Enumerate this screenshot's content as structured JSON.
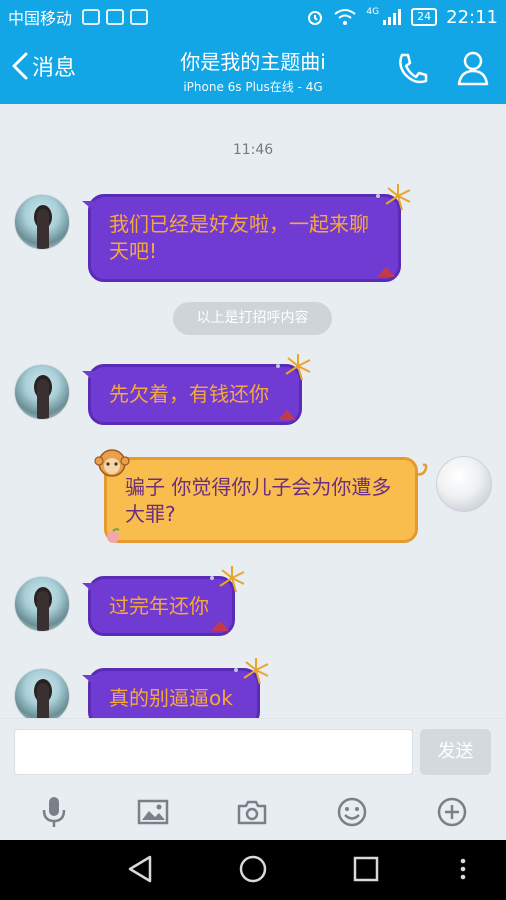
{
  "status_bar": {
    "carrier": "中国移动",
    "network": "4G",
    "battery": "24",
    "time": "22:11"
  },
  "header": {
    "back_label": "消息",
    "title": "你是我的主题曲i",
    "subtitle": "iPhone 6s Plus在线 - 4G",
    "icons": [
      "phone-icon",
      "profile-icon"
    ]
  },
  "messages": {
    "timestamp": "11:46",
    "notice": "以上是打招呼内容",
    "items": [
      {
        "sender": "contact",
        "text": "我们已经是好友啦，一起来聊天吧!"
      },
      {
        "sender": "contact",
        "text": "先欠着，有钱还你"
      },
      {
        "sender": "me",
        "text": "骗子 你觉得你儿子会为你遭多大罪?"
      },
      {
        "sender": "contact",
        "text": "过完年还你"
      },
      {
        "sender": "contact",
        "text": "真的别逼逼ok"
      }
    ]
  },
  "input": {
    "placeholder": "",
    "send_label": "发送"
  },
  "toolbar": {
    "icons": [
      "microphone-icon",
      "image-icon",
      "camera-icon",
      "emoji-icon",
      "add-icon"
    ]
  },
  "nav_bar": {
    "icons": [
      "back-triangle-icon",
      "home-circle-icon",
      "recents-square-icon",
      "more-dots-icon"
    ]
  },
  "colors": {
    "header": "#13a6e6",
    "bubble_purple": "#6f3bd2",
    "bubble_text_orange": "#f7a83b",
    "sent_bubble": "#f8bd4d",
    "sent_text": "#6b2f7e"
  }
}
